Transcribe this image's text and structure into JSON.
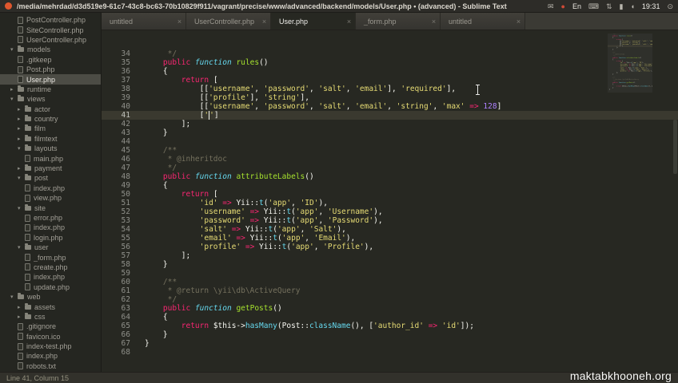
{
  "titlebar": {
    "title": "/media/mehrdad/d3d519e9-61c7-43c8-bc63-70b10829f911/vagrant/precise/www/advanced/backend/models/User.php • (advanced) - Sublime Text",
    "tray": [
      {
        "name": "mail-indicator-icon",
        "glyph": "✉",
        "color": "#b9b6ae"
      },
      {
        "name": "sync-indicator-icon",
        "glyph": "●",
        "color": "#cf4a36"
      },
      {
        "name": "keyboard-layout-indicator",
        "glyph": "En",
        "color": "#e9e6df"
      },
      {
        "name": "keyboard-icon",
        "glyph": "⌨",
        "color": "#b9b6ae"
      },
      {
        "name": "network-icon",
        "glyph": "⇅",
        "color": "#b9b6ae"
      },
      {
        "name": "battery-icon",
        "glyph": "▮",
        "color": "#b9b6ae"
      },
      {
        "name": "volume-icon",
        "glyph": "◖",
        "color": "#b9b6ae"
      },
      {
        "name": "clock",
        "glyph": "19:31",
        "color": "#f2f0ea"
      },
      {
        "name": "session-menu-icon",
        "glyph": "⊙",
        "color": "#b9b6ae"
      }
    ]
  },
  "tabs": [
    {
      "label": "untitled",
      "active": false
    },
    {
      "label": "UserController.php",
      "active": false
    },
    {
      "label": "User.php",
      "active": true
    },
    {
      "label": "_form.php",
      "active": false
    },
    {
      "label": "untitled",
      "active": false
    }
  ],
  "sidebar": {
    "items": [
      {
        "label": "PostController.php",
        "type": "file",
        "level": 2
      },
      {
        "label": "SiteController.php",
        "type": "file",
        "level": 2
      },
      {
        "label": "UserController.php",
        "type": "file",
        "level": 2
      },
      {
        "label": "models",
        "type": "folder",
        "open": true,
        "level": 1
      },
      {
        "label": ".gitkeep",
        "type": "file",
        "level": 2
      },
      {
        "label": "Post.php",
        "type": "file",
        "level": 2
      },
      {
        "label": "User.php",
        "type": "file",
        "level": 2,
        "selected": true
      },
      {
        "label": "runtime",
        "type": "folder",
        "open": false,
        "level": 1
      },
      {
        "label": "views",
        "type": "folder",
        "open": true,
        "level": 1
      },
      {
        "label": "actor",
        "type": "folder",
        "open": false,
        "level": 2
      },
      {
        "label": "country",
        "type": "folder",
        "open": false,
        "level": 2
      },
      {
        "label": "film",
        "type": "folder",
        "open": false,
        "level": 2
      },
      {
        "label": "filmtext",
        "type": "folder",
        "open": false,
        "level": 2
      },
      {
        "label": "layouts",
        "type": "folder",
        "open": true,
        "level": 2
      },
      {
        "label": "main.php",
        "type": "file",
        "level": 3
      },
      {
        "label": "payment",
        "type": "folder",
        "open": false,
        "level": 2
      },
      {
        "label": "post",
        "type": "folder",
        "open": true,
        "level": 2
      },
      {
        "label": "index.php",
        "type": "file",
        "level": 3
      },
      {
        "label": "view.php",
        "type": "file",
        "level": 3
      },
      {
        "label": "site",
        "type": "folder",
        "open": true,
        "level": 2
      },
      {
        "label": "error.php",
        "type": "file",
        "level": 3
      },
      {
        "label": "index.php",
        "type": "file",
        "level": 3
      },
      {
        "label": "login.php",
        "type": "file",
        "level": 3
      },
      {
        "label": "user",
        "type": "folder",
        "open": true,
        "level": 2
      },
      {
        "label": "_form.php",
        "type": "file",
        "level": 3
      },
      {
        "label": "create.php",
        "type": "file",
        "level": 3
      },
      {
        "label": "index.php",
        "type": "file",
        "level": 3
      },
      {
        "label": "update.php",
        "type": "file",
        "level": 3
      },
      {
        "label": "web",
        "type": "folder",
        "open": true,
        "level": 1
      },
      {
        "label": "assets",
        "type": "folder",
        "open": false,
        "level": 2
      },
      {
        "label": "css",
        "type": "folder",
        "open": false,
        "level": 2
      },
      {
        "label": ".gitignore",
        "type": "file",
        "level": 2
      },
      {
        "label": "favicon.ico",
        "type": "file",
        "level": 2
      },
      {
        "label": "index-test.php",
        "type": "file",
        "level": 2
      },
      {
        "label": "index.php",
        "type": "file",
        "level": 2
      },
      {
        "label": "robots.txt",
        "type": "file",
        "level": 2
      }
    ]
  },
  "editor": {
    "current_line": 41,
    "lines": [
      {
        "n": 34,
        "t": [
          [
            "c",
            "     */"
          ]
        ]
      },
      {
        "n": 35,
        "t": [
          [
            "p",
            "    "
          ],
          [
            "k",
            "public"
          ],
          [
            "p",
            " "
          ],
          [
            "f",
            "function"
          ],
          [
            "p",
            " "
          ],
          [
            "fn",
            "rules"
          ],
          [
            "p",
            "()"
          ]
        ]
      },
      {
        "n": 36,
        "t": [
          [
            "p",
            "    {"
          ]
        ]
      },
      {
        "n": 37,
        "t": [
          [
            "p",
            "        "
          ],
          [
            "k",
            "return"
          ],
          [
            "p",
            " ["
          ]
        ]
      },
      {
        "n": 38,
        "t": [
          [
            "p",
            "            [["
          ],
          [
            "s",
            "'username'"
          ],
          [
            "p",
            ", "
          ],
          [
            "s",
            "'password'"
          ],
          [
            "p",
            ", "
          ],
          [
            "s",
            "'salt'"
          ],
          [
            "p",
            ", "
          ],
          [
            "s",
            "'email'"
          ],
          [
            "p",
            "], "
          ],
          [
            "s",
            "'required'"
          ],
          [
            "p",
            "],"
          ]
        ]
      },
      {
        "n": 39,
        "t": [
          [
            "p",
            "            [["
          ],
          [
            "s",
            "'profile'"
          ],
          [
            "p",
            "], "
          ],
          [
            "s",
            "'string'"
          ],
          [
            "p",
            "],"
          ]
        ]
      },
      {
        "n": 40,
        "t": [
          [
            "p",
            "            [["
          ],
          [
            "s",
            "'username'"
          ],
          [
            "p",
            ", "
          ],
          [
            "s",
            "'password'"
          ],
          [
            "p",
            ", "
          ],
          [
            "s",
            "'salt'"
          ],
          [
            "p",
            ", "
          ],
          [
            "s",
            "'email'"
          ],
          [
            "p",
            ", "
          ],
          [
            "s",
            "'string'"
          ],
          [
            "p",
            ", "
          ],
          [
            "s",
            "'max'"
          ],
          [
            "p",
            " "
          ],
          [
            "k",
            "=>"
          ],
          [
            "p",
            " "
          ],
          [
            "n",
            "128"
          ],
          [
            "p",
            "]"
          ]
        ]
      },
      {
        "n": 41,
        "t": [
          [
            "p",
            "            ["
          ],
          [
            "s",
            "'"
          ],
          [
            "caret",
            ""
          ],
          [
            "s",
            "'"
          ],
          [
            "p",
            "]"
          ]
        ]
      },
      {
        "n": 42,
        "t": [
          [
            "p",
            "        ];"
          ]
        ]
      },
      {
        "n": 43,
        "t": [
          [
            "p",
            "    }"
          ]
        ]
      },
      {
        "n": 44,
        "t": []
      },
      {
        "n": 45,
        "t": [
          [
            "c",
            "    /**"
          ]
        ]
      },
      {
        "n": 46,
        "t": [
          [
            "c",
            "     * @inheritdoc"
          ]
        ]
      },
      {
        "n": 47,
        "t": [
          [
            "c",
            "     */"
          ]
        ]
      },
      {
        "n": 48,
        "t": [
          [
            "p",
            "    "
          ],
          [
            "k",
            "public"
          ],
          [
            "p",
            " "
          ],
          [
            "f",
            "function"
          ],
          [
            "p",
            " "
          ],
          [
            "fn",
            "attributeLabels"
          ],
          [
            "p",
            "()"
          ]
        ]
      },
      {
        "n": 49,
        "t": [
          [
            "p",
            "    {"
          ]
        ]
      },
      {
        "n": 50,
        "t": [
          [
            "p",
            "        "
          ],
          [
            "k",
            "return"
          ],
          [
            "p",
            " ["
          ]
        ]
      },
      {
        "n": 51,
        "t": [
          [
            "p",
            "            "
          ],
          [
            "s",
            "'id'"
          ],
          [
            "p",
            " "
          ],
          [
            "k",
            "=>"
          ],
          [
            "p",
            " Yii::"
          ],
          [
            "m",
            "t"
          ],
          [
            "p",
            "("
          ],
          [
            "s",
            "'app'"
          ],
          [
            "p",
            ", "
          ],
          [
            "s",
            "'ID'"
          ],
          [
            "p",
            "),"
          ]
        ]
      },
      {
        "n": 52,
        "t": [
          [
            "p",
            "            "
          ],
          [
            "s",
            "'username'"
          ],
          [
            "p",
            " "
          ],
          [
            "k",
            "=>"
          ],
          [
            "p",
            " Yii::"
          ],
          [
            "m",
            "t"
          ],
          [
            "p",
            "("
          ],
          [
            "s",
            "'app'"
          ],
          [
            "p",
            ", "
          ],
          [
            "s",
            "'Username'"
          ],
          [
            "p",
            "),"
          ]
        ]
      },
      {
        "n": 53,
        "t": [
          [
            "p",
            "            "
          ],
          [
            "s",
            "'password'"
          ],
          [
            "p",
            " "
          ],
          [
            "k",
            "=>"
          ],
          [
            "p",
            " Yii::"
          ],
          [
            "m",
            "t"
          ],
          [
            "p",
            "("
          ],
          [
            "s",
            "'app'"
          ],
          [
            "p",
            ", "
          ],
          [
            "s",
            "'Password'"
          ],
          [
            "p",
            "),"
          ]
        ]
      },
      {
        "n": 54,
        "t": [
          [
            "p",
            "            "
          ],
          [
            "s",
            "'salt'"
          ],
          [
            "p",
            " "
          ],
          [
            "k",
            "=>"
          ],
          [
            "p",
            " Yii::"
          ],
          [
            "m",
            "t"
          ],
          [
            "p",
            "("
          ],
          [
            "s",
            "'app'"
          ],
          [
            "p",
            ", "
          ],
          [
            "s",
            "'Salt'"
          ],
          [
            "p",
            "),"
          ]
        ]
      },
      {
        "n": 55,
        "t": [
          [
            "p",
            "            "
          ],
          [
            "s",
            "'email'"
          ],
          [
            "p",
            " "
          ],
          [
            "k",
            "=>"
          ],
          [
            "p",
            " Yii::"
          ],
          [
            "m",
            "t"
          ],
          [
            "p",
            "("
          ],
          [
            "s",
            "'app'"
          ],
          [
            "p",
            ", "
          ],
          [
            "s",
            "'Email'"
          ],
          [
            "p",
            "),"
          ]
        ]
      },
      {
        "n": 56,
        "t": [
          [
            "p",
            "            "
          ],
          [
            "s",
            "'profile'"
          ],
          [
            "p",
            " "
          ],
          [
            "k",
            "=>"
          ],
          [
            "p",
            " Yii::"
          ],
          [
            "m",
            "t"
          ],
          [
            "p",
            "("
          ],
          [
            "s",
            "'app'"
          ],
          [
            "p",
            ", "
          ],
          [
            "s",
            "'Profile'"
          ],
          [
            "p",
            "),"
          ]
        ]
      },
      {
        "n": 57,
        "t": [
          [
            "p",
            "        ];"
          ]
        ]
      },
      {
        "n": 58,
        "t": [
          [
            "p",
            "    }"
          ]
        ]
      },
      {
        "n": 59,
        "t": []
      },
      {
        "n": 60,
        "t": [
          [
            "c",
            "    /**"
          ]
        ]
      },
      {
        "n": 61,
        "t": [
          [
            "c",
            "     * @return \\yii\\db\\ActiveQuery"
          ]
        ]
      },
      {
        "n": 62,
        "t": [
          [
            "c",
            "     */"
          ]
        ]
      },
      {
        "n": 63,
        "t": [
          [
            "p",
            "    "
          ],
          [
            "k",
            "public"
          ],
          [
            "p",
            " "
          ],
          [
            "f",
            "function"
          ],
          [
            "p",
            " "
          ],
          [
            "fn",
            "getPosts"
          ],
          [
            "p",
            "()"
          ]
        ]
      },
      {
        "n": 64,
        "t": [
          [
            "p",
            "    {"
          ]
        ]
      },
      {
        "n": 65,
        "t": [
          [
            "p",
            "        "
          ],
          [
            "k",
            "return"
          ],
          [
            "p",
            " $this->"
          ],
          [
            "m",
            "hasMany"
          ],
          [
            "p",
            "(Post::"
          ],
          [
            "m",
            "className"
          ],
          [
            "p",
            "(), ["
          ],
          [
            "s",
            "'author_id'"
          ],
          [
            "p",
            " "
          ],
          [
            "k",
            "=>"
          ],
          [
            "p",
            " "
          ],
          [
            "s",
            "'id'"
          ],
          [
            "p",
            "]);"
          ]
        ]
      },
      {
        "n": 66,
        "t": [
          [
            "p",
            "    }"
          ]
        ]
      },
      {
        "n": 67,
        "t": [
          [
            "p",
            "}"
          ]
        ]
      },
      {
        "n": 68,
        "t": []
      }
    ]
  },
  "statusbar": {
    "position": "Line 41, Column 15"
  },
  "watermark": "maktabkhooneh.org",
  "colors": {
    "background": "#272822",
    "keyword": "#f92672",
    "storage_type": "#66d9ef",
    "function_name": "#a6e22e",
    "string": "#e6db74",
    "number": "#ae81ff",
    "comment": "#75715e",
    "line_highlight": "#3a392f"
  }
}
